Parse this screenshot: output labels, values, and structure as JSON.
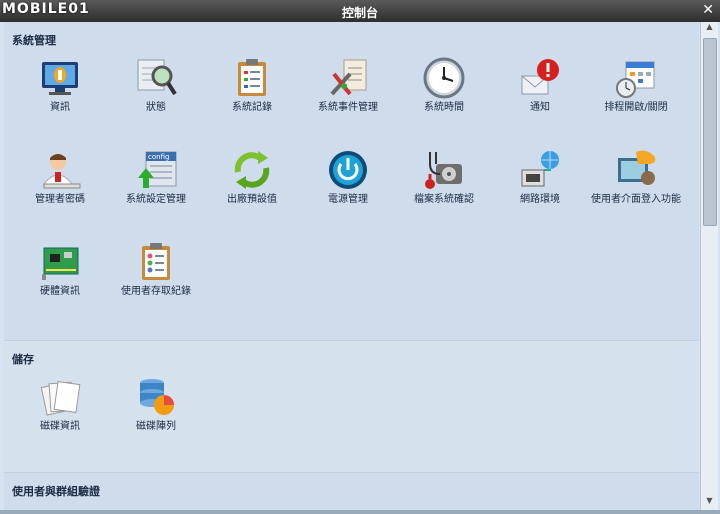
{
  "window": {
    "title": "控制台",
    "watermark": "MOBILE01"
  },
  "sections": {
    "system": {
      "title": "系統管理",
      "items": [
        {
          "label": "資訊"
        },
        {
          "label": "狀態"
        },
        {
          "label": "系統記錄"
        },
        {
          "label": "系統事件管理"
        },
        {
          "label": "系統時間"
        },
        {
          "label": "通知"
        },
        {
          "label": "排程開啟/關閉"
        },
        {
          "label": "管理者密碼"
        },
        {
          "label": "系統設定管理"
        },
        {
          "label": "出廠預設值"
        },
        {
          "label": "電源管理"
        },
        {
          "label": "檔案系統確認"
        },
        {
          "label": "網路環境"
        },
        {
          "label": "使用者介面登入功能"
        },
        {
          "label": "硬體資訊"
        },
        {
          "label": "使用者存取紀錄"
        }
      ]
    },
    "storage": {
      "title": "儲存",
      "items": [
        {
          "label": "磁碟資訊"
        },
        {
          "label": "磁碟陣列"
        }
      ]
    },
    "users": {
      "title": "使用者與群組驗證"
    }
  },
  "icons": {
    "info": "monitor-info-icon",
    "status": "magnifier-status-icon",
    "log": "clipboard-log-icon",
    "event": "tools-event-icon",
    "time": "clock-icon",
    "notify": "envelope-alert-icon",
    "schedule": "calendar-clock-icon",
    "admin": "admin-user-icon",
    "config": "config-icon",
    "reset": "recycle-arrows-icon",
    "power": "power-icon",
    "fscheck": "stethoscope-disk-icon",
    "network": "network-globe-icon",
    "ui": "ui-login-icon",
    "hardware": "circuit-board-icon",
    "access": "clipboard-users-icon",
    "diskinfo": "disk-papers-icon",
    "raid": "raid-database-icon"
  }
}
